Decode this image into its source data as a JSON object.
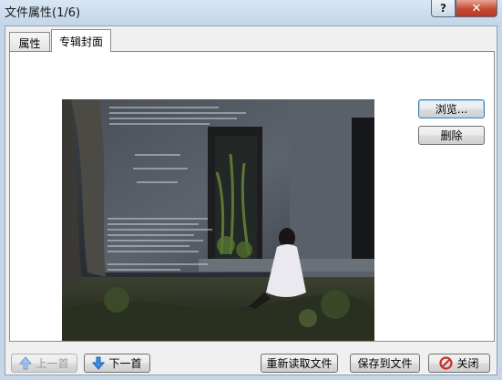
{
  "window": {
    "title": "文件属性(1/6)",
    "help_label": "?",
    "close_label": "✕"
  },
  "tabs": [
    {
      "label": "属性",
      "active": false
    },
    {
      "label": "专辑封面",
      "active": true
    }
  ],
  "cover_image": {
    "description_icon": "album-cover-image"
  },
  "side_buttons": {
    "browse_label": "浏览...",
    "delete_label": "删除"
  },
  "bottom_buttons": {
    "prev_label": "上一首",
    "next_label": "下一首",
    "reload_label": "重新读取文件",
    "save_label": "保存到文件",
    "close_label": "关闭"
  },
  "colors": {
    "accent": "#3c7fb1",
    "arrow_blue": "#2f7fd0",
    "close_red": "#c8312c"
  }
}
